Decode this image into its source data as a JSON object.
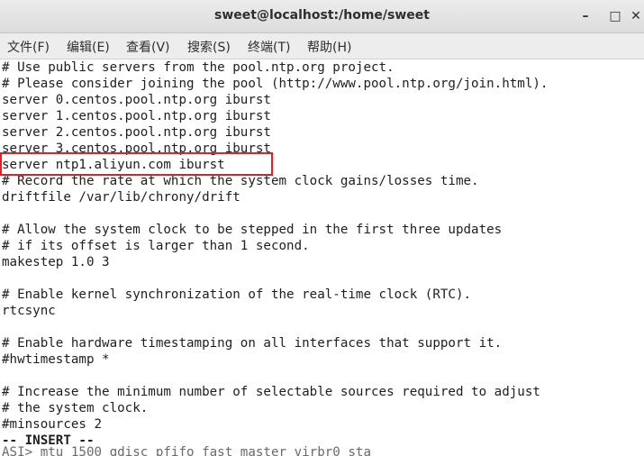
{
  "window": {
    "title": "sweet@localhost:/home/sweet",
    "minimize_glyph": "–",
    "maximize_glyph": "□",
    "close_glyph": "✕"
  },
  "menubar": {
    "items": [
      {
        "label": "文件(F)"
      },
      {
        "label": "编辑(E)"
      },
      {
        "label": "查看(V)"
      },
      {
        "label": "搜索(S)"
      },
      {
        "label": "终端(T)"
      },
      {
        "label": "帮助(H)"
      }
    ]
  },
  "terminal": {
    "lines": [
      "# Use public servers from the pool.ntp.org project.",
      "# Please consider joining the pool (http://www.pool.ntp.org/join.html).",
      "server 0.centos.pool.ntp.org iburst",
      "server 1.centos.pool.ntp.org iburst",
      "server 2.centos.pool.ntp.org iburst",
      "server 3.centos.pool.ntp.org iburst",
      "server ntp1.aliyun.com iburst",
      "# Record the rate at which the system clock gains/losses time.",
      "driftfile /var/lib/chrony/drift",
      "",
      "# Allow the system clock to be stepped in the first three updates",
      "# if its offset is larger than 1 second.",
      "makestep 1.0 3",
      "",
      "# Enable kernel synchronization of the real-time clock (RTC).",
      "rtcsync",
      "",
      "# Enable hardware timestamping on all interfaces that support it.",
      "#hwtimestamp *",
      "",
      "# Increase the minimum number of selectable sources required to adjust",
      "# the system clock.",
      "#minsources 2",
      "-- INSERT --"
    ],
    "bleed_line": "ASI> mtu 1500 qdisc pfifo fast master virbr0 sta",
    "highlight_color": "#e0202a"
  }
}
